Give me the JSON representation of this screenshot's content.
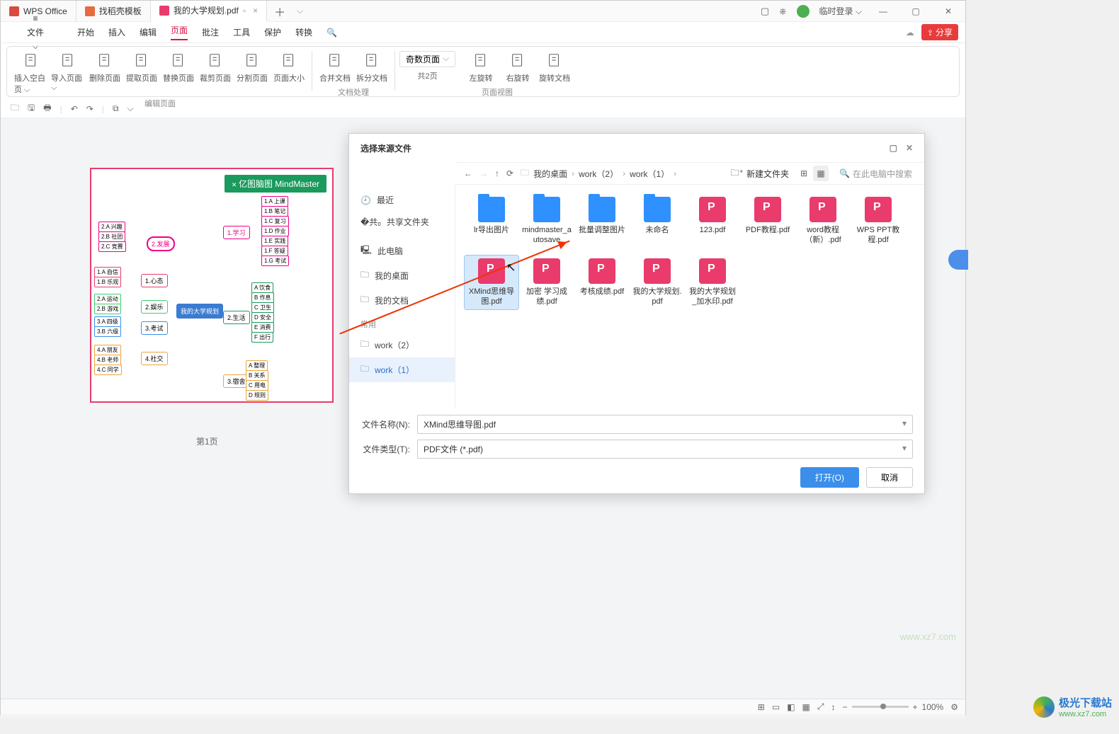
{
  "titlebar": {
    "tabs": [
      {
        "label": "WPS Office"
      },
      {
        "label": "找稻壳模板"
      },
      {
        "label": "我的大学规划.pdf"
      }
    ],
    "login": "临时登录"
  },
  "menu": {
    "file": "文件",
    "items": [
      "开始",
      "插入",
      "编辑",
      "页面",
      "批注",
      "工具",
      "保护",
      "转换"
    ],
    "active": "页面",
    "share": "分享"
  },
  "ribbon": {
    "g1": {
      "btns": [
        "插入空白页",
        "导入页面",
        "删除页面",
        "提取页面",
        "替换页面",
        "裁剪页面",
        "分割页面",
        "页面大小"
      ],
      "label": "编辑页面"
    },
    "g2": {
      "btns": [
        "合并文档",
        "拆分文档"
      ],
      "label": "文档处理"
    },
    "g3": {
      "odd": "奇数页面",
      "pages": "共2页",
      "btns": [
        "左旋转",
        "右旋转",
        "旋转文档"
      ],
      "label": "页面视图"
    }
  },
  "page": {
    "badge": "亿图脑图\nMindMaster",
    "center": "我的大学规划",
    "pn": "第1页"
  },
  "dialog": {
    "title": "选择来源文件",
    "side": {
      "recent": "最近",
      "share": "共享文件夹",
      "pc": "此电脑",
      "desktop": "我的桌面",
      "docs": "我的文档",
      "freq": "常用",
      "w2": "work（2）",
      "w1": "work（1）"
    },
    "bc": [
      "我的桌面",
      "work（2）",
      "work（1）"
    ],
    "newfolder": "新建文件夹",
    "search_ph": "在此电脑中搜索",
    "files": [
      {
        "name": "lr导出图片",
        "type": "folder"
      },
      {
        "name": "mindmaster_autosave",
        "type": "folder"
      },
      {
        "name": "批量调整图片",
        "type": "folder"
      },
      {
        "name": "未命名",
        "type": "folder"
      },
      {
        "name": "123.pdf",
        "type": "pdf"
      },
      {
        "name": "PDF教程.pdf",
        "type": "pdf"
      },
      {
        "name": "word教程（新）.pdf",
        "type": "pdf"
      },
      {
        "name": "WPS PPT教程.pdf",
        "type": "pdf"
      },
      {
        "name": "XMind思维导图.pdf",
        "type": "pdf",
        "sel": true
      },
      {
        "name": "加密 学习成绩.pdf",
        "type": "pdf"
      },
      {
        "name": "考核成绩.pdf",
        "type": "pdf"
      },
      {
        "name": "我的大学规划.pdf",
        "type": "pdf"
      },
      {
        "name": "我的大学规划_加水印.pdf",
        "type": "pdf"
      }
    ],
    "fname_lbl": "文件名称(N):",
    "fname_val": "XMind思维导图.pdf",
    "ftype_lbl": "文件类型(T):",
    "ftype_val": "PDF文件 (*.pdf)",
    "open": "打开(O)",
    "cancel": "取消"
  },
  "status": {
    "zoom": "100%"
  },
  "wm1": "www.xz7.com",
  "wm2": {
    "t1": "极光下载站",
    "t2": "www.xz7.com"
  }
}
